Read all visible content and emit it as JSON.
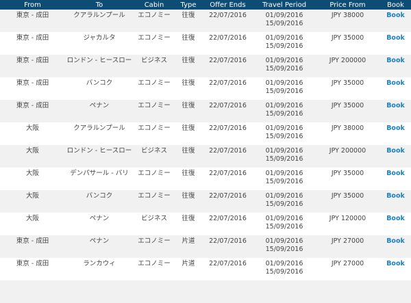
{
  "header": {
    "from": "From",
    "to": "To",
    "cabin": "Cabin",
    "type": "Type",
    "offer_ends": "Offer Ends",
    "travel_period": "Travel Period",
    "price_from": "Price From",
    "book": "Book"
  },
  "rows": [
    {
      "from": "東京 - 成田",
      "to": "クアラルンプール",
      "cabin": "エコノミー",
      "type": "往復",
      "offer_ends": "22/07/2016",
      "period_start": "01/09/2016",
      "period_end": "15/09/2016",
      "price": "JPY 38000",
      "book": "Book"
    },
    {
      "from": "東京 - 成田",
      "to": "ジャカルタ",
      "cabin": "エコノミー",
      "type": "往復",
      "offer_ends": "22/07/2016",
      "period_start": "01/09/2016",
      "period_end": "15/09/2016",
      "price": "JPY 35000",
      "book": "Book"
    },
    {
      "from": "東京 - 成田",
      "to": "ロンドン - ヒースロー",
      "cabin": "ビジネス",
      "type": "往復",
      "offer_ends": "22/07/2016",
      "period_start": "01/09/2016",
      "period_end": "15/09/2016",
      "price": "JPY 200000",
      "book": "Book"
    },
    {
      "from": "東京 - 成田",
      "to": "バンコク",
      "cabin": "エコノミー",
      "type": "往復",
      "offer_ends": "22/07/2016",
      "period_start": "01/09/2016",
      "period_end": "15/09/2016",
      "price": "JPY 35000",
      "book": "Book"
    },
    {
      "from": "東京 - 成田",
      "to": "ペナン",
      "cabin": "エコノミー",
      "type": "往復",
      "offer_ends": "22/07/2016",
      "period_start": "01/09/2016",
      "period_end": "15/09/2016",
      "price": "JPY 35000",
      "book": "Book"
    },
    {
      "from": "大阪",
      "to": "クアラルンプール",
      "cabin": "エコノミー",
      "type": "往復",
      "offer_ends": "22/07/2016",
      "period_start": "01/09/2016",
      "period_end": "15/09/2016",
      "price": "JPY 38000",
      "book": "Book"
    },
    {
      "from": "大阪",
      "to": "ロンドン - ヒースロー",
      "cabin": "ビジネス",
      "type": "往復",
      "offer_ends": "22/07/2016",
      "period_start": "01/09/2016",
      "period_end": "15/09/2016",
      "price": "JPY 200000",
      "book": "Book"
    },
    {
      "from": "大阪",
      "to": "デンパサール - バリ",
      "cabin": "エコノミー",
      "type": "往復",
      "offer_ends": "22/07/2016",
      "period_start": "01/09/2016",
      "period_end": "15/09/2016",
      "price": "JPY 35000",
      "book": "Book"
    },
    {
      "from": "大阪",
      "to": "バンコク",
      "cabin": "エコノミー",
      "type": "往復",
      "offer_ends": "22/07/2016",
      "period_start": "01/09/2016",
      "period_end": "15/09/2016",
      "price": "JPY 35000",
      "book": "Book"
    },
    {
      "from": "大阪",
      "to": "ペナン",
      "cabin": "ビジネス",
      "type": "往復",
      "offer_ends": "22/07/2016",
      "period_start": "01/09/2016",
      "period_end": "15/09/2016",
      "price": "JPY 120000",
      "book": "Book"
    },
    {
      "from": "東京 - 成田",
      "to": "ペナン",
      "cabin": "エコノミー",
      "type": "片道",
      "offer_ends": "22/07/2016",
      "period_start": "01/09/2016",
      "period_end": "15/09/2016",
      "price": "JPY 27000",
      "book": "Book"
    },
    {
      "from": "東京 - 成田",
      "to": "ランカウィ",
      "cabin": "エコノミー",
      "type": "片道",
      "offer_ends": "22/07/2016",
      "period_start": "01/09/2016",
      "period_end": "15/09/2016",
      "price": "JPY 27000",
      "book": "Book"
    },
    {
      "from": "",
      "to": "",
      "cabin": "",
      "type": "",
      "offer_ends": "",
      "period_start": "",
      "period_end": "",
      "price": "",
      "book": ""
    }
  ],
  "colors": {
    "header_bg": "#0d4c75",
    "link": "#1a80c4",
    "row_alt": "#f1f1f1"
  }
}
